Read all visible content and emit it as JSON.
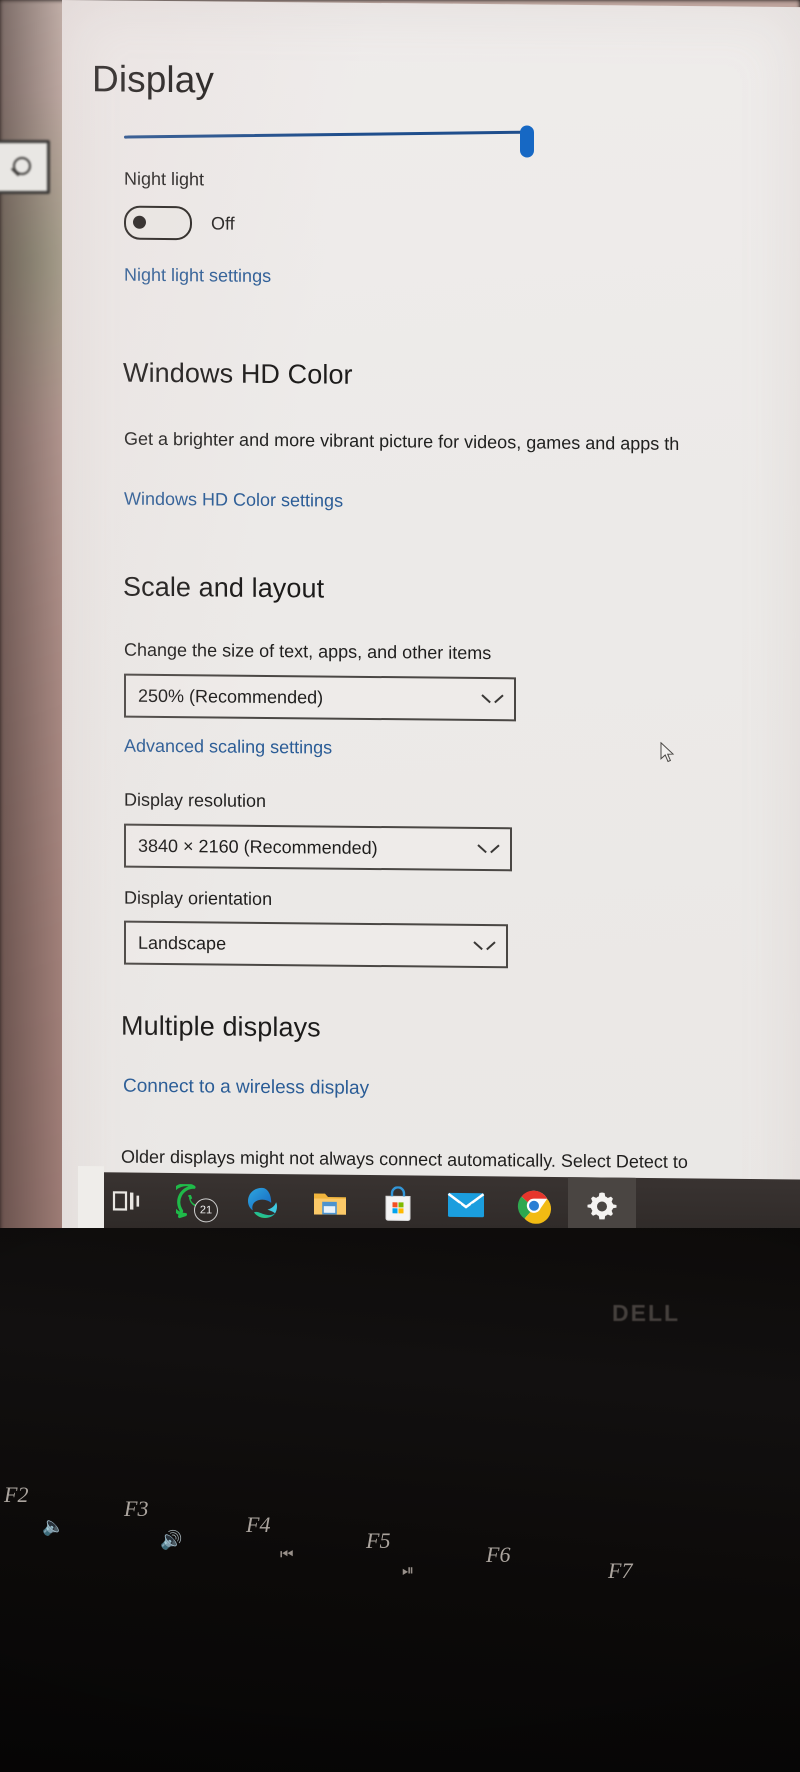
{
  "room": {
    "left_search_icon": "search-icon"
  },
  "settings": {
    "page_title": "Display",
    "brightness": {
      "name": "brightness-slider",
      "value": 100
    },
    "night_light": {
      "label": "Night light",
      "toggle_state": "Off",
      "link": "Night light settings"
    },
    "hd_color": {
      "heading": "Windows HD Color",
      "description": "Get a brighter and more vibrant picture for videos, games and apps th",
      "link": "Windows HD Color settings"
    },
    "scale_layout": {
      "heading": "Scale and layout",
      "scale_label": "Change the size of text, apps, and other items",
      "scale_value": "250% (Recommended)",
      "advanced_link": "Advanced scaling settings",
      "resolution_label": "Display resolution",
      "resolution_value": "3840 × 2160 (Recommended)",
      "orientation_label": "Display orientation",
      "orientation_value": "Landscape"
    },
    "multiple_displays": {
      "heading": "Multiple displays",
      "link": "Connect to a wireless display",
      "note": "Older displays might not always connect automatically. Select Detect to"
    }
  },
  "taskbar": {
    "items": [
      {
        "name": "task-view-icon",
        "label": "Task View",
        "badge": null
      },
      {
        "name": "whatsapp-icon",
        "label": "WhatsApp",
        "badge": "21"
      },
      {
        "name": "edge-icon",
        "label": "Microsoft Edge",
        "badge": null
      },
      {
        "name": "file-explorer-icon",
        "label": "File Explorer",
        "badge": null
      },
      {
        "name": "microsoft-store-icon",
        "label": "Microsoft Store",
        "badge": null
      },
      {
        "name": "mail-icon",
        "label": "Mail",
        "badge": null
      },
      {
        "name": "chrome-icon",
        "label": "Google Chrome",
        "badge": null
      },
      {
        "name": "settings-gear-icon",
        "label": "Settings",
        "badge": null
      }
    ]
  },
  "laptop": {
    "brand": "DELL",
    "function_keys": [
      {
        "key": "F2",
        "glyph": "speaker-mute-icon"
      },
      {
        "key": "F3",
        "glyph": "speaker-volume-icon"
      },
      {
        "key": "F4",
        "glyph": "previous-track-icon"
      },
      {
        "key": "F5",
        "glyph": "play-pause-icon"
      },
      {
        "key": "F6",
        "glyph": ""
      },
      {
        "key": "F7",
        "glyph": ""
      }
    ]
  },
  "colors": {
    "accent_blue": "#1668c4",
    "link_blue": "#2a5c96",
    "screen_bg": "#eceae8",
    "taskbar_bg": "#2f2a28"
  }
}
